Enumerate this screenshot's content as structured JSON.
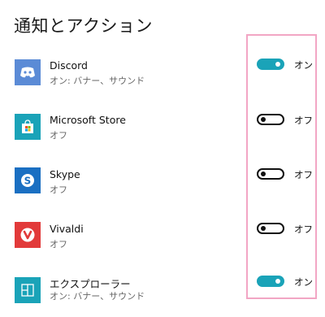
{
  "title": "通知とアクション",
  "apps": [
    {
      "name": "Discord",
      "sub": "オン: バナー、サウンド",
      "state": "on",
      "state_label": "オン",
      "icon": "discord-icon",
      "icon_bg": "#5b8bd6"
    },
    {
      "name": "Microsoft Store",
      "sub": "オフ",
      "state": "off",
      "state_label": "オフ",
      "icon": "store-icon",
      "icon_bg": "#1aa3b8"
    },
    {
      "name": "Skype",
      "sub": "オフ",
      "state": "off",
      "state_label": "オフ",
      "icon": "skype-icon",
      "icon_bg": "#1a6fc2"
    },
    {
      "name": "Vivaldi",
      "sub": "オフ",
      "state": "off",
      "state_label": "オフ",
      "icon": "vivaldi-icon",
      "icon_bg": "#e23a3a"
    },
    {
      "name": "エクスプローラー",
      "sub": "オン: バナー、サウンド",
      "state": "on",
      "state_label": "オン",
      "icon": "explorer-icon",
      "icon_bg": "#1aa3b8"
    }
  ],
  "colors": {
    "toggle_on": "#1aa3b8",
    "highlight_border": "#f2a6c4"
  }
}
